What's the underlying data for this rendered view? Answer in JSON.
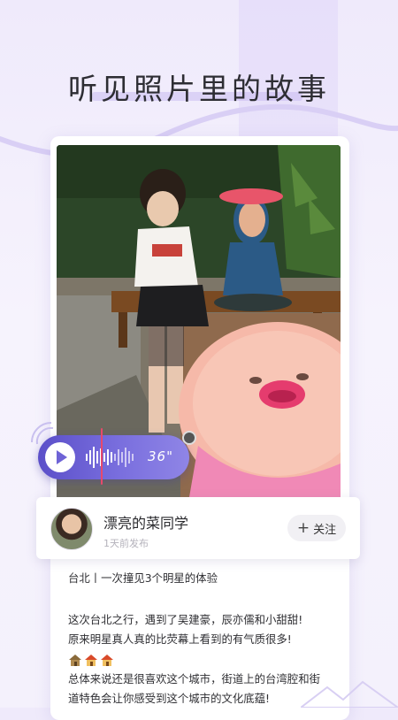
{
  "headline": "听见照片里的故事",
  "user": {
    "name": "漂亮的菜同学",
    "time": "1天前发布",
    "follow": {
      "icon": "plus-icon",
      "plus": "+",
      "label": "关注"
    }
  },
  "voice": {
    "duration": "36\"",
    "play_icon": "play-icon"
  },
  "post": {
    "title": "台北丨一次撞见3个明星的体验",
    "lines": [
      "这次台北之行，遇到了吴建豪，辰亦儒和小甜甜!",
      "原来明星真人真的比荧幕上看到的有气质很多!",
      "总体来说还是很喜欢这个城市，街道上的台湾腔和街",
      "道特色会让你感受到这个城市的文化底蕴!"
    ],
    "emoji": [
      "house-icon",
      "house-icon",
      "house-icon"
    ]
  },
  "colors": {
    "accent": "#6e63d6",
    "scrubber": "#e8496b",
    "background": "#f1edfb"
  }
}
